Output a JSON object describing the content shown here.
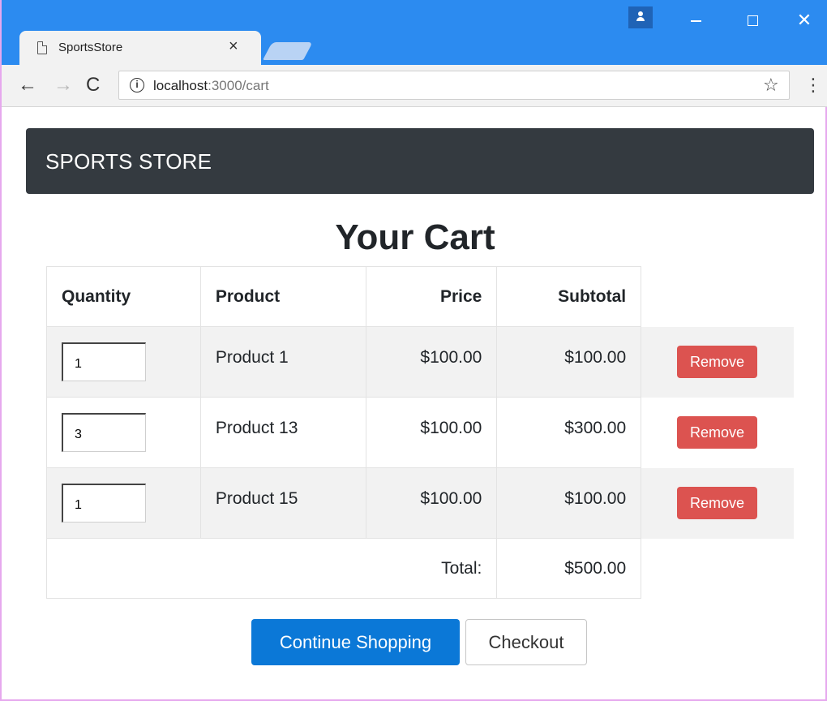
{
  "browser": {
    "tab_title": "SportsStore",
    "tab_close": "×",
    "url_host": "localhost",
    "url_path": ":3000/cart",
    "win_close": "✕",
    "icons": {
      "back": "←",
      "forward": "→",
      "reload": "C",
      "info": "i",
      "star": "☆",
      "menu": "⋮"
    }
  },
  "navbar": {
    "brand": "SPORTS STORE"
  },
  "cart": {
    "title": "Your Cart",
    "headers": {
      "quantity": "Quantity",
      "product": "Product",
      "price": "Price",
      "subtotal": "Subtotal"
    },
    "rows": [
      {
        "quantity": "1",
        "product": "Product 1",
        "price": "$100.00",
        "subtotal": "$100.00",
        "action": "Remove"
      },
      {
        "quantity": "3",
        "product": "Product 13",
        "price": "$100.00",
        "subtotal": "$300.00",
        "action": "Remove"
      },
      {
        "quantity": "1",
        "product": "Product 15",
        "price": "$100.00",
        "subtotal": "$100.00",
        "action": "Remove"
      }
    ],
    "total_label": "Total:",
    "total_value": "$500.00"
  },
  "buttons": {
    "continue": "Continue Shopping",
    "checkout": "Checkout"
  },
  "colors": {
    "titlebar": "#2c8bf0",
    "navbar": "#343a40",
    "primary": "#0b78d7",
    "danger": "#dc5350"
  }
}
